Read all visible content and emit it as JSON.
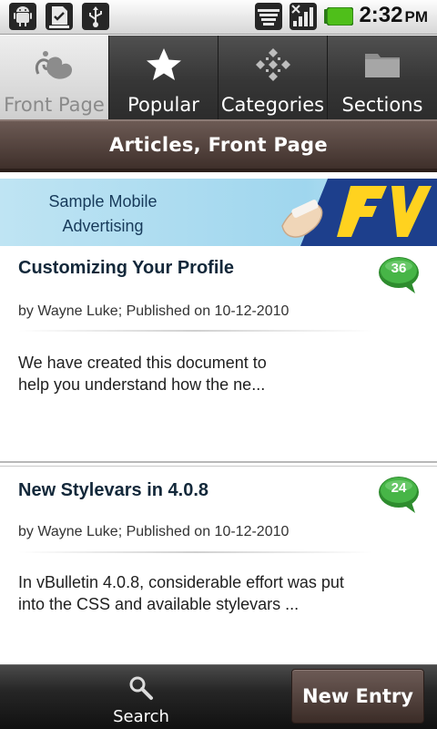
{
  "status_bar": {
    "icons": [
      "android-icon",
      "download-complete-icon",
      "usb-icon",
      "wifi-icon",
      "signal-icon",
      "battery-icon"
    ],
    "time": "2:32",
    "ampm": "PM"
  },
  "tabs": [
    {
      "label": "Front Page",
      "icon": "vbulletin-logo-icon",
      "active": true
    },
    {
      "label": "Popular",
      "icon": "star-icon",
      "active": false
    },
    {
      "label": "Categories",
      "icon": "categories-icon",
      "active": false
    },
    {
      "label": "Sections",
      "icon": "folder-icon",
      "active": false
    }
  ],
  "header": {
    "title": "Articles, Front Page"
  },
  "ad": {
    "line1": "Sample Mobile",
    "line2": "Advertising"
  },
  "articles": [
    {
      "title": "Customizing Your Profile",
      "meta": "by Wayne Luke; Published on 10-12-2010",
      "excerpt_line1": "We have created this document to",
      "excerpt_line2": "help you understand how the ne...",
      "comments": "36"
    },
    {
      "title": "New Stylevars in 4.0.8",
      "meta": "by Wayne Luke; Published on 10-12-2010",
      "excerpt_line1": "In vBulletin 4.0.8, considerable effort was put",
      "excerpt_line2": "into the CSS and available stylevars ...",
      "comments": "24"
    }
  ],
  "bottom_bar": {
    "search_label": "Search",
    "new_entry_label": "New Entry"
  },
  "colors": {
    "accent_brown": "#4f3e38",
    "comment_green": "#3aa53a",
    "title_navy": "#13283a"
  }
}
